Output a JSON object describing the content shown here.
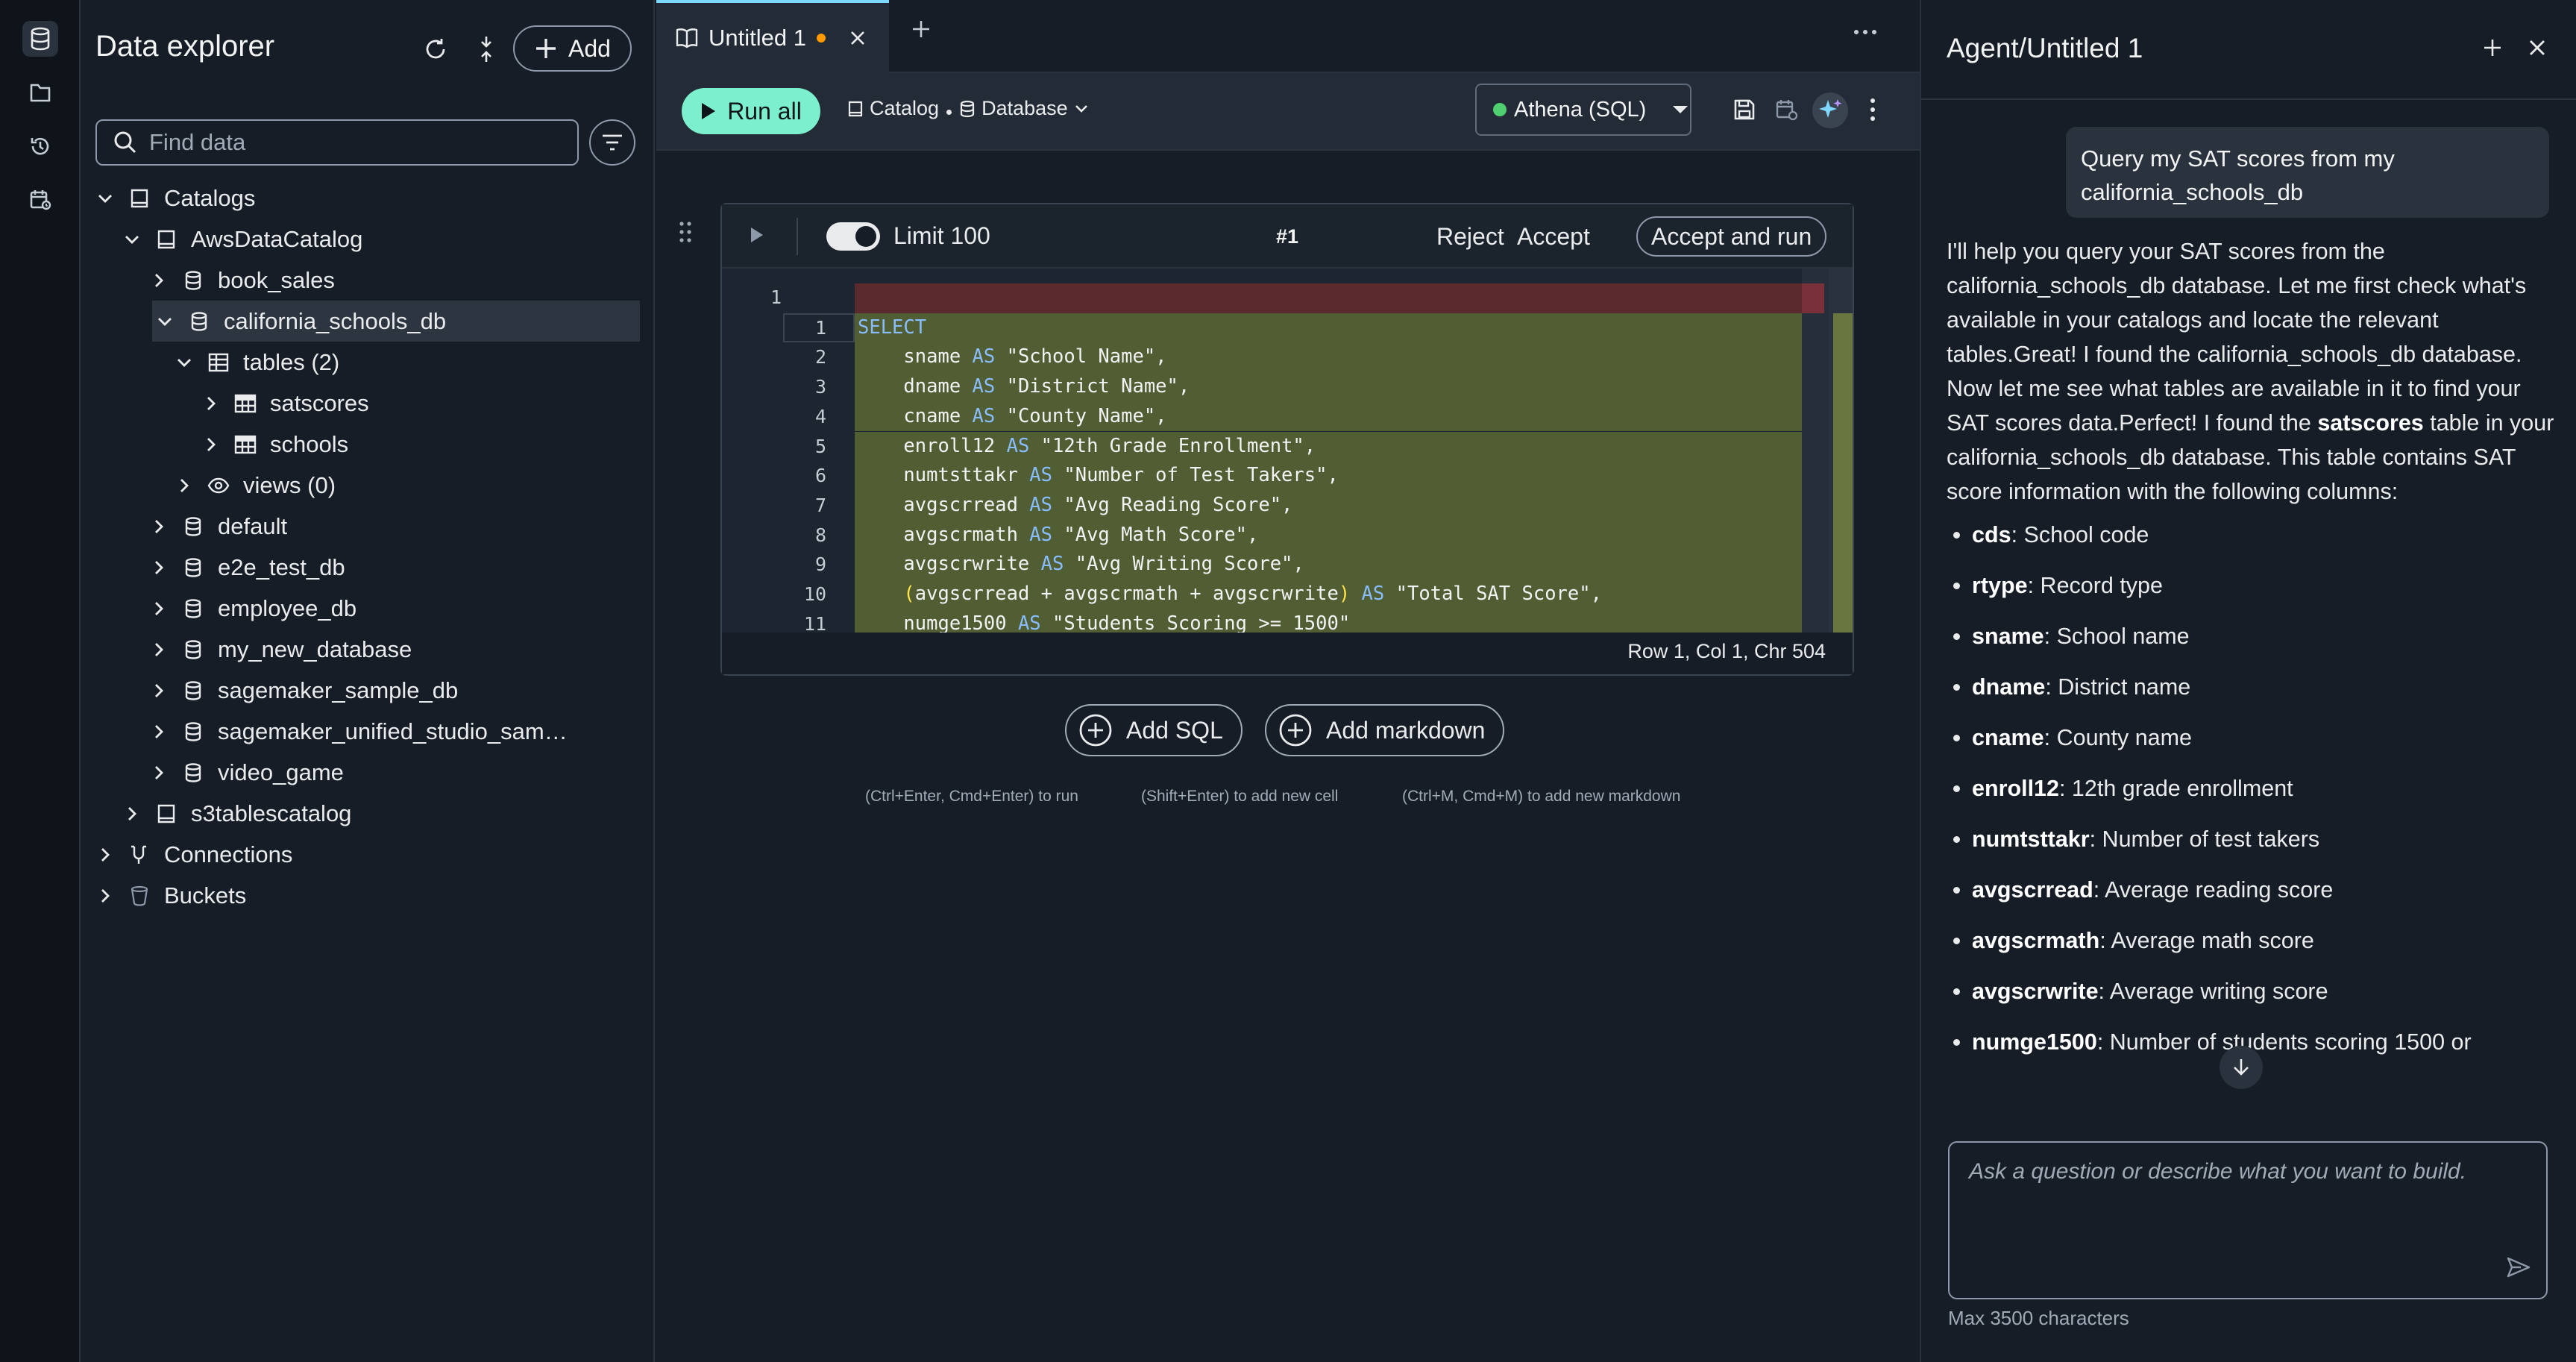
{
  "explorer": {
    "title": "Data explorer",
    "add_label": "Add",
    "search_placeholder": "Find data",
    "tree": [
      {
        "label": "Catalogs",
        "level": 0,
        "expanded": true,
        "icon": "catalog-icon"
      },
      {
        "label": "AwsDataCatalog",
        "level": 1,
        "expanded": true,
        "icon": "catalog-icon"
      },
      {
        "label": "book_sales",
        "level": 2,
        "expanded": false,
        "icon": "database-icon"
      },
      {
        "label": "california_schools_db",
        "level": 2,
        "expanded": true,
        "selected": true,
        "icon": "database-icon"
      },
      {
        "label": "tables (2)",
        "level": 3,
        "expanded": true,
        "icon": "tables-icon"
      },
      {
        "label": "satscores",
        "level": 4,
        "expanded": false,
        "icon": "table-icon"
      },
      {
        "label": "schools",
        "level": 4,
        "expanded": false,
        "icon": "table-icon"
      },
      {
        "label": "views (0)",
        "level": 3,
        "expanded": false,
        "icon": "eye-icon"
      },
      {
        "label": "default",
        "level": 2,
        "expanded": false,
        "icon": "database-icon"
      },
      {
        "label": "e2e_test_db",
        "level": 2,
        "expanded": false,
        "icon": "database-icon"
      },
      {
        "label": "employee_db",
        "level": 2,
        "expanded": false,
        "icon": "database-icon"
      },
      {
        "label": "my_new_database",
        "level": 2,
        "expanded": false,
        "icon": "database-icon"
      },
      {
        "label": "sagemaker_sample_db",
        "level": 2,
        "expanded": false,
        "icon": "database-icon"
      },
      {
        "label": "sagemaker_unified_studio_sam…",
        "level": 2,
        "expanded": false,
        "icon": "database-icon"
      },
      {
        "label": "video_game",
        "level": 2,
        "expanded": false,
        "icon": "database-icon"
      },
      {
        "label": "s3tablescatalog",
        "level": 1,
        "expanded": false,
        "icon": "catalog-icon"
      },
      {
        "label": "Connections",
        "level": 0,
        "expanded": false,
        "icon": "connections-icon"
      },
      {
        "label": "Buckets",
        "level": 0,
        "expanded": false,
        "icon": "bucket-icon"
      }
    ]
  },
  "tabs": {
    "active_tab": "Untitled 1",
    "unsaved_dot_color": "#ff9900"
  },
  "toolbar": {
    "run_all": "Run all",
    "catalog": "Catalog",
    "database": "Database",
    "engine": "Athena (SQL)",
    "engine_status_color": "#4fcf70"
  },
  "cell": {
    "limit_label": "Limit 100",
    "cell_number": "#1",
    "reject": "Reject",
    "accept": "Accept",
    "accept_and_run": "Accept and run",
    "removed_line_number": "1",
    "code_lines": [
      {
        "n": "1",
        "parts": [
          {
            "t": "SELECT",
            "k": "kw"
          }
        ]
      },
      {
        "n": "2",
        "parts": [
          {
            "t": "    sname "
          },
          {
            "t": "AS",
            "k": "kw"
          },
          {
            "t": " \"School Name\","
          }
        ]
      },
      {
        "n": "3",
        "parts": [
          {
            "t": "    dname "
          },
          {
            "t": "AS",
            "k": "kw"
          },
          {
            "t": " \"District Name\","
          }
        ]
      },
      {
        "n": "4",
        "parts": [
          {
            "t": "    cname "
          },
          {
            "t": "AS",
            "k": "kw"
          },
          {
            "t": " \"County Name\","
          }
        ]
      },
      {
        "n": "5",
        "parts": [
          {
            "t": "    enroll12 "
          },
          {
            "t": "AS",
            "k": "kw"
          },
          {
            "t": " \"12th Grade Enrollment\","
          }
        ]
      },
      {
        "n": "6",
        "parts": [
          {
            "t": "    numtsttakr "
          },
          {
            "t": "AS",
            "k": "kw"
          },
          {
            "t": " \"Number of Test Takers\","
          }
        ]
      },
      {
        "n": "7",
        "parts": [
          {
            "t": "    avgscrread "
          },
          {
            "t": "AS",
            "k": "kw"
          },
          {
            "t": " \"Avg Reading Score\","
          }
        ]
      },
      {
        "n": "8",
        "parts": [
          {
            "t": "    avgscrmath "
          },
          {
            "t": "AS",
            "k": "kw"
          },
          {
            "t": " \"Avg Math Score\","
          }
        ]
      },
      {
        "n": "9",
        "parts": [
          {
            "t": "    avgscrwrite "
          },
          {
            "t": "AS",
            "k": "kw"
          },
          {
            "t": " \"Avg Writing Score\","
          }
        ]
      },
      {
        "n": "10",
        "parts": [
          {
            "t": "    "
          },
          {
            "t": "(",
            "k": "paren"
          },
          {
            "t": "avgscrread + avgscrmath + avgscrwrite"
          },
          {
            "t": ")",
            "k": "paren"
          },
          {
            "t": " "
          },
          {
            "t": "AS",
            "k": "kw"
          },
          {
            "t": " \"Total SAT Score\","
          }
        ]
      },
      {
        "n": "11",
        "parts": [
          {
            "t": "    numge1500 "
          },
          {
            "t": "AS",
            "k": "kw"
          },
          {
            "t": " \"Students Scoring >= 1500\""
          }
        ]
      }
    ],
    "status": "Row 1,  Col 1,  Chr 504",
    "removed_color": "#5a2a2e",
    "added_color": "#515d33"
  },
  "actions": {
    "add_sql": "Add SQL",
    "add_markdown": "Add markdown",
    "hint_run": "(Ctrl+Enter, Cmd+Enter) to run",
    "hint_new_cell": "(Shift+Enter) to add new cell",
    "hint_markdown": "(Ctrl+M, Cmd+M) to add new markdown"
  },
  "agent": {
    "title": "Agent/Untitled 1",
    "user_message": "Query my SAT scores from my california_schools_db",
    "reply_intro_1": "I'll help you query your SAT scores from the california_schools_db database. Let me first check what's available in your catalogs and locate the relevant tables.Great! I found the california_schools_db database. Now let me see what tables are available in it to find your SAT scores data.Perfect! I found the ",
    "reply_table": "satscores",
    "reply_intro_2": " table in your california_schools_db database. This table contains SAT score information with the following columns:",
    "columns": [
      {
        "name": "cds",
        "desc": ": School code"
      },
      {
        "name": "rtype",
        "desc": ": Record type"
      },
      {
        "name": "sname",
        "desc": ": School name"
      },
      {
        "name": "dname",
        "desc": ": District name"
      },
      {
        "name": "cname",
        "desc": ": County name"
      },
      {
        "name": "enroll12",
        "desc": ": 12th grade enrollment"
      },
      {
        "name": "numtsttakr",
        "desc": ": Number of test takers"
      },
      {
        "name": "avgscrread",
        "desc": ": Average reading score"
      },
      {
        "name": "avgscrmath",
        "desc": ": Average math score"
      },
      {
        "name": "avgscrwrite",
        "desc": ": Average writing score"
      },
      {
        "name": "numge1500",
        "desc": ": Number of students scoring 1500 or"
      }
    ],
    "input_placeholder": "Ask a question or describe what you want to build.",
    "char_limit": "Max 3500 characters"
  }
}
